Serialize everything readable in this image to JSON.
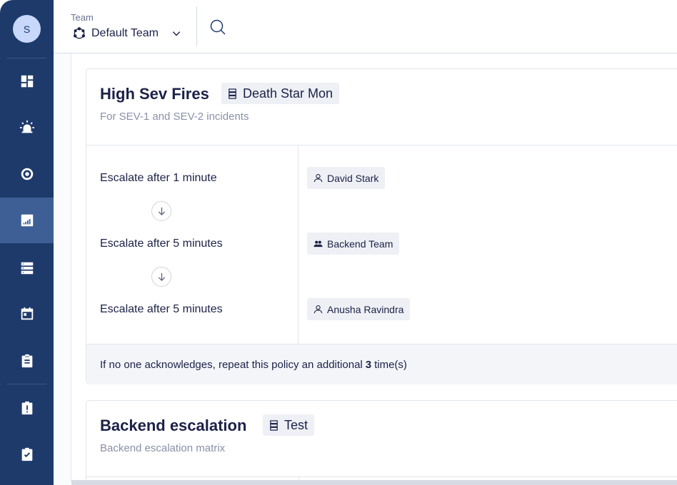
{
  "sidebar": {
    "avatar_initial": "S",
    "items": [
      {
        "icon": "dashboard-icon",
        "active": false
      },
      {
        "icon": "siren-icon",
        "active": false
      },
      {
        "icon": "target-icon",
        "active": false
      },
      {
        "icon": "escalation-chart-icon",
        "active": true
      },
      {
        "icon": "server-stack-icon",
        "active": false
      },
      {
        "icon": "calendar-icon",
        "active": false
      },
      {
        "icon": "clipboard-icon",
        "active": false
      },
      {
        "icon": "clipboard-alert-icon",
        "active": false
      },
      {
        "icon": "clipboard-check-icon",
        "active": false
      }
    ]
  },
  "header": {
    "team_label": "Team",
    "team_name": "Default Team"
  },
  "policies": [
    {
      "title": "High Sev Fires",
      "service": "Death Star Mon",
      "description": "For SEV-1 and SEV-2 incidents",
      "steps": [
        {
          "label": "Escalate after 1 minute",
          "target": "David Stark",
          "target_type": "user"
        },
        {
          "label": "Escalate after 5 minutes",
          "target": "Backend Team",
          "target_type": "team"
        },
        {
          "label": "Escalate after 5 minutes",
          "target": "Anusha Ravindra",
          "target_type": "user"
        }
      ],
      "repeat_prefix": "If no one acknowledges, repeat this policy an additional",
      "repeat_count": "3",
      "repeat_suffix": "time(s)"
    },
    {
      "title": "Backend escalation",
      "service": "Test",
      "description": "Backend escalation matrix"
    }
  ],
  "colors": {
    "sidebar_bg": "#1e3a6b",
    "sidebar_active": "#3d5f96",
    "text_primary": "#1c2147",
    "text_muted": "#8a90a8",
    "chip_bg": "#eef0f5"
  }
}
